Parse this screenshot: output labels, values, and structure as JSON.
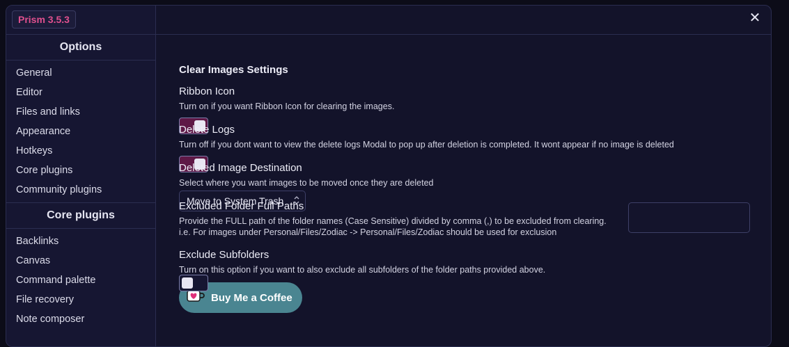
{
  "app": {
    "version_badge": "Prism 3.5.3"
  },
  "sidebar": {
    "options_heading": "Options",
    "options_items": [
      {
        "label": "General"
      },
      {
        "label": "Editor"
      },
      {
        "label": "Files and links"
      },
      {
        "label": "Appearance"
      },
      {
        "label": "Hotkeys"
      },
      {
        "label": "Core plugins"
      },
      {
        "label": "Community plugins"
      }
    ],
    "core_heading": "Core plugins",
    "core_items": [
      {
        "label": "Backlinks"
      },
      {
        "label": "Canvas"
      },
      {
        "label": "Command palette"
      },
      {
        "label": "File recovery"
      },
      {
        "label": "Note composer"
      }
    ]
  },
  "header": {
    "close_icon": "close-icon",
    "close_glyph": "✕"
  },
  "settings": {
    "title": "Clear Images Settings",
    "ribbon_icon": {
      "name": "Ribbon Icon",
      "desc": "Turn on if you want Ribbon Icon for clearing the images.",
      "enabled": true
    },
    "delete_logs": {
      "name": "Delete Logs",
      "desc": "Turn off if you dont want to view the delete logs Modal to pop up after deletion is completed. It wont appear if no image is deleted",
      "enabled": true
    },
    "destination": {
      "name": "Deleted Image Destination",
      "desc": "Select where you want images to be moved once they are deleted",
      "selected": "Move to System Trash",
      "chevron_glyph": "⌃⌄"
    },
    "excluded_paths": {
      "name": "Excluded Folder Full Paths",
      "desc_line1": "Provide the FULL path of the folder names (Case Sensitive) divided by comma (,) to be excluded from clearing.",
      "desc_line2": "i.e. For images under Personal/Files/Zodiac -> Personal/Files/Zodiac should be used for exclusion",
      "value": ""
    },
    "exclude_subfolders": {
      "name": "Exclude Subfolders",
      "desc": "Turn on this option if you want to also exclude all subfolders of the folder paths provided above.",
      "enabled": false
    },
    "coffee_button": {
      "label": "Buy Me a Coffee",
      "icon": "coffee-cup-icon"
    }
  },
  "colors": {
    "accent_toggle": "#5e1846",
    "badge_text": "#e0508e",
    "coffee_bg": "#4a8591"
  }
}
